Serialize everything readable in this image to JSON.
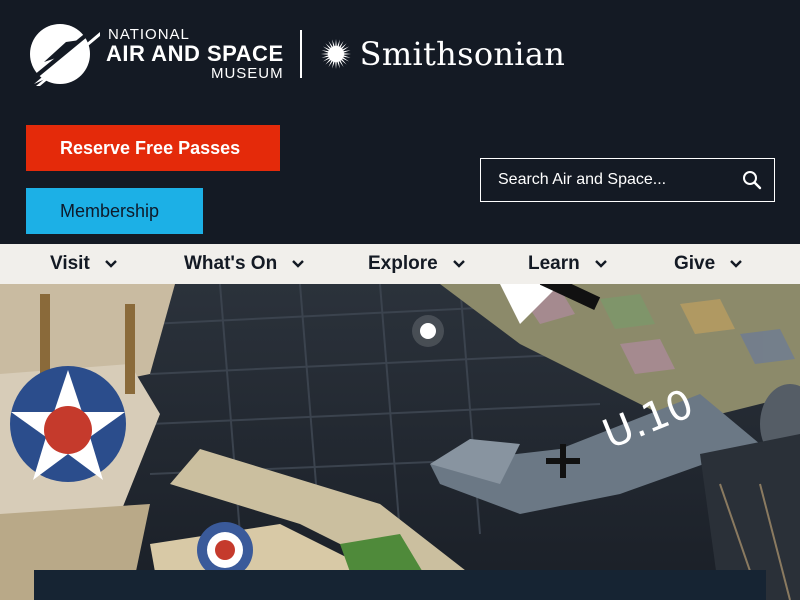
{
  "header": {
    "logo": {
      "line1": "NATIONAL",
      "line2": "AIR AND SPACE",
      "line3": "MUSEUM",
      "partner": "Smithsonian"
    },
    "reserve_label": "Reserve Free Passes",
    "membership_label": "Membership",
    "search": {
      "placeholder": "Search Air and Space..."
    }
  },
  "nav": {
    "items": [
      {
        "label": "Visit"
      },
      {
        "label": "What's On"
      },
      {
        "label": "Explore"
      },
      {
        "label": "Learn"
      },
      {
        "label": "Give"
      }
    ]
  },
  "colors": {
    "header_bg": "#141a24",
    "reserve": "#e42a0a",
    "membership": "#1cb0e6",
    "nav_bg": "#f1efeb"
  },
  "icons": {
    "brand": "nasm-logo-icon",
    "partner": "smithsonian-sun-icon",
    "search": "search-icon",
    "chevron": "chevron-down-icon"
  }
}
